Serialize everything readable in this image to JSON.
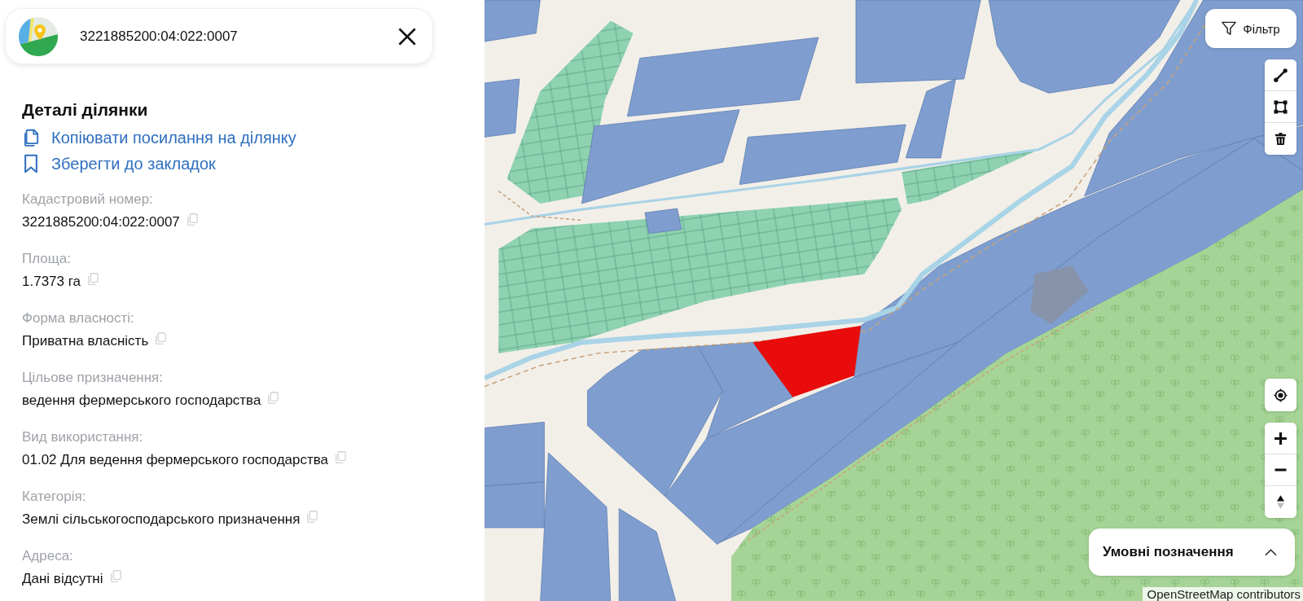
{
  "search": {
    "value": "3221885200:04:022:0007"
  },
  "details": {
    "title": "Деталі ділянки",
    "actions": [
      {
        "kind": "copy",
        "label": "Копіювати посилання на ділянку"
      },
      {
        "kind": "bookmark",
        "label": "Зберегти до закладок"
      }
    ],
    "fields": [
      {
        "label": "Кадастровий номер:",
        "value": "3221885200:04:022:0007"
      },
      {
        "label": "Площа:",
        "value": "1.7373 га"
      },
      {
        "label": "Форма власності:",
        "value": "Приватна власність"
      },
      {
        "label": "Цільове призначення:",
        "value": "ведення фермерського господарства"
      },
      {
        "label": "Вид використання:",
        "value": "01.02 Для ведення фермерського господарства"
      },
      {
        "label": "Категорія:",
        "value": "Землі сільськогосподарського призначення"
      },
      {
        "label": "Адреса:",
        "value": "Дані відсутні"
      }
    ]
  },
  "map": {
    "filter_button": "Фільтр",
    "legend_button": "Умовні позначення",
    "attribution": "OpenStreetMap contributors"
  }
}
